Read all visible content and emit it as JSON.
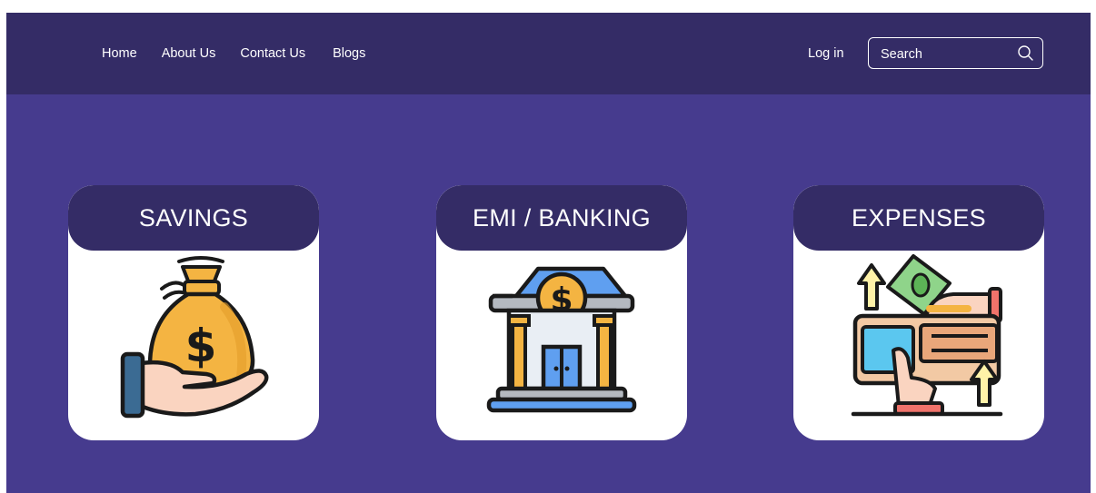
{
  "nav": {
    "links": [
      "Home",
      "About Us",
      "Contact Us",
      "Blogs"
    ],
    "login_label": "Log in",
    "search": {
      "placeholder": "Search"
    }
  },
  "cards": [
    {
      "title": "SAVINGS",
      "icon": "money-bag-in-hand-icon"
    },
    {
      "title": "EMI / BANKING",
      "icon": "bank-building-icon"
    },
    {
      "title": "EXPENSES",
      "icon": "wallet-expenses-icon"
    }
  ],
  "colors": {
    "page_background": "#463b8e",
    "navbar": "#342c66",
    "card_header": "#342c66",
    "card_body": "#ffffff"
  }
}
